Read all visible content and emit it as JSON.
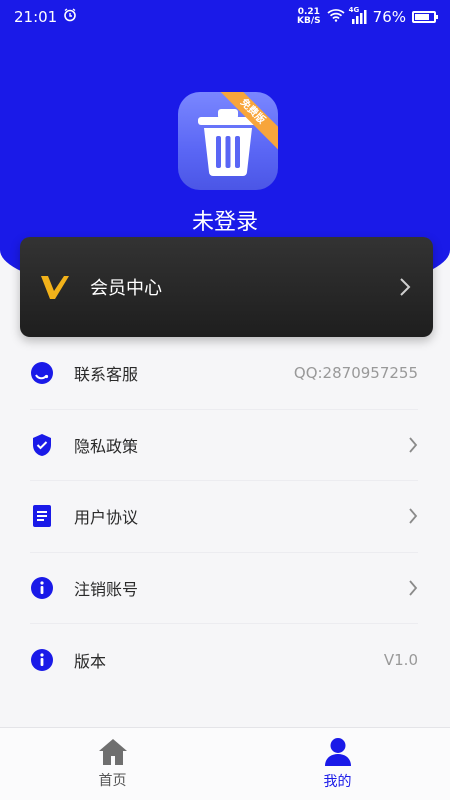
{
  "status_bar": {
    "time": "21:01",
    "net_speed_value": "0.21",
    "net_speed_unit": "KB/S",
    "network_type": "4G",
    "battery": "76%",
    "battery_level": 0.76
  },
  "header": {
    "badge_text": "免费版",
    "login_title": "未登录"
  },
  "vip_card": {
    "label": "会员中心"
  },
  "menu": {
    "items": [
      {
        "label": "联系客服",
        "value": "QQ:2870957255"
      },
      {
        "label": "隐私政策"
      },
      {
        "label": "用户协议"
      },
      {
        "label": "注销账号"
      },
      {
        "label": "版本",
        "value": "V1.0"
      }
    ]
  },
  "tabs": [
    {
      "label": "首页",
      "active": false
    },
    {
      "label": "我的",
      "active": true
    }
  ],
  "colors": {
    "brand_blue": "#1a1ae8",
    "badge_orange": "#f8a53b",
    "vip_gold": "#f2b21a"
  }
}
